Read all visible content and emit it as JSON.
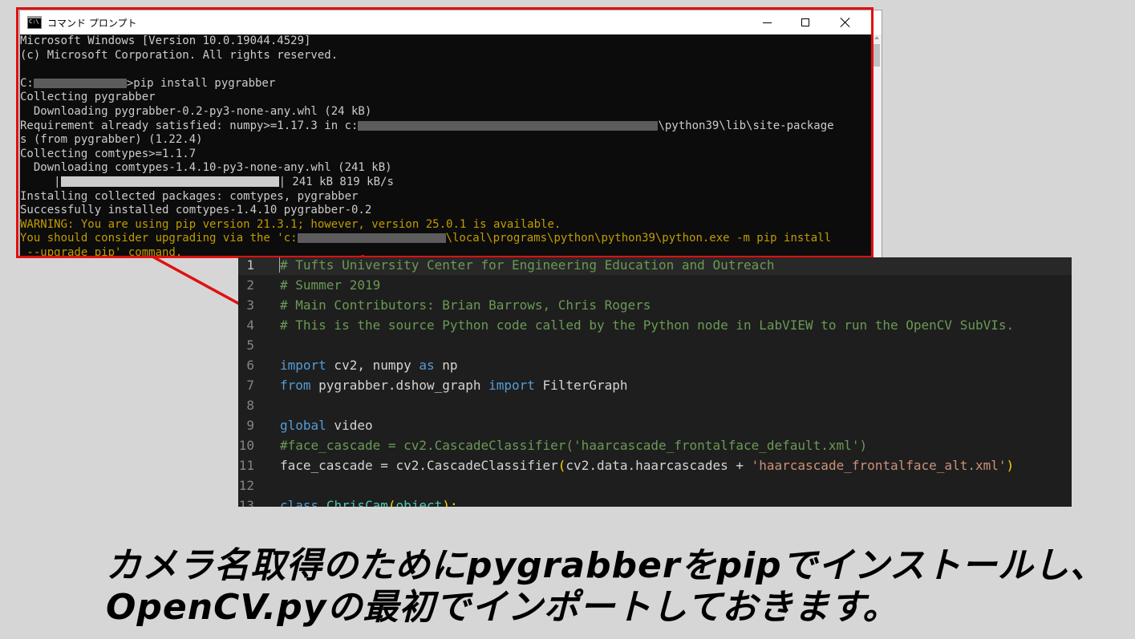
{
  "cmd_window": {
    "icon_label": "C:\\",
    "title": "コマンド プロンプト",
    "lines": [
      {
        "type": "text",
        "text": "Microsoft Windows [Version 10.0.19044.4529]"
      },
      {
        "type": "text",
        "text": "(c) Microsoft Corporation. All rights reserved."
      },
      {
        "type": "text",
        "text": ""
      },
      {
        "type": "prompt",
        "before": "C:",
        "after": ">pip install pygrabber"
      },
      {
        "type": "text",
        "text": "Collecting pygrabber"
      },
      {
        "type": "text",
        "text": "  Downloading pygrabber-0.2-py3-none-any.whl (24 kB)"
      },
      {
        "type": "path",
        "before": "Requirement already satisfied: numpy>=1.17.3 in c:",
        "after": "\\python39\\lib\\site-package"
      },
      {
        "type": "text",
        "text": "s (from pygrabber) (1.22.4)"
      },
      {
        "type": "text",
        "text": "Collecting comtypes>=1.1.7"
      },
      {
        "type": "text",
        "text": "  Downloading comtypes-1.4.10-py3-none-any.whl (241 kB)"
      },
      {
        "type": "progress",
        "before": "     |",
        "after": "| 241 kB 819 kB/s"
      },
      {
        "type": "text",
        "text": "Installing collected packages: comtypes, pygrabber"
      },
      {
        "type": "text",
        "text": "Successfully installed comtypes-1.4.10 pygrabber-0.2"
      },
      {
        "type": "warn",
        "text": "WARNING: You are using pip version 21.3.1; however, version 25.0.1 is available."
      },
      {
        "type": "warnpath",
        "before": "You should consider upgrading via the 'c:",
        "after": "\\local\\programs\\python\\python39\\python.exe -m pip install"
      },
      {
        "type": "warn",
        "text": " --upgrade pip' command."
      }
    ]
  },
  "editor": {
    "current_line": 1,
    "lines": [
      {
        "n": "1",
        "tokens": [
          {
            "t": "# Tufts University Center for Engineering Education and Outreach",
            "c": "comment"
          }
        ]
      },
      {
        "n": "2",
        "tokens": [
          {
            "t": "# Summer 2019",
            "c": "comment"
          }
        ]
      },
      {
        "n": "3",
        "tokens": [
          {
            "t": "# Main Contributors: Brian Barrows, Chris Rogers",
            "c": "comment"
          }
        ]
      },
      {
        "n": "4",
        "tokens": [
          {
            "t": "# This is the source Python code called by the Python node in LabVIEW to run the OpenCV SubVIs.",
            "c": "comment"
          }
        ]
      },
      {
        "n": "5",
        "tokens": []
      },
      {
        "n": "6",
        "tokens": [
          {
            "t": "import",
            "c": "kw"
          },
          {
            "t": " cv2, numpy ",
            "c": "text"
          },
          {
            "t": "as",
            "c": "kw"
          },
          {
            "t": " np",
            "c": "text"
          }
        ]
      },
      {
        "n": "7",
        "tokens": [
          {
            "t": "from",
            "c": "kw"
          },
          {
            "t": " pygrabber.dshow_graph ",
            "c": "text"
          },
          {
            "t": "import",
            "c": "kw"
          },
          {
            "t": " FilterGraph",
            "c": "text"
          }
        ]
      },
      {
        "n": "8",
        "tokens": []
      },
      {
        "n": "9",
        "tokens": [
          {
            "t": "global",
            "c": "kw"
          },
          {
            "t": " video",
            "c": "text"
          }
        ]
      },
      {
        "n": "10",
        "tokens": [
          {
            "t": "#face_cascade = cv2.CascadeClassifier('haarcascade_frontalface_default.xml')",
            "c": "comment"
          }
        ]
      },
      {
        "n": "11",
        "tokens": [
          {
            "t": "face_cascade = cv2.CascadeClassifier",
            "c": "text"
          },
          {
            "t": "(",
            "c": "paren"
          },
          {
            "t": "cv2.data.haarcascades + ",
            "c": "text"
          },
          {
            "t": "'haarcascade_frontalface_alt.xml'",
            "c": "str"
          },
          {
            "t": ")",
            "c": "paren"
          }
        ]
      },
      {
        "n": "12",
        "tokens": []
      },
      {
        "n": "13",
        "tokens": [
          {
            "t": "class",
            "c": "kw"
          },
          {
            "t": " ",
            "c": "text"
          },
          {
            "t": "ChrisCam",
            "c": "cls"
          },
          {
            "t": "(",
            "c": "paren"
          },
          {
            "t": "object",
            "c": "cls"
          },
          {
            "t": "):",
            "c": "paren"
          }
        ]
      }
    ]
  },
  "caption": {
    "line1": "カメラ名取得のためにpygrabberをpipでインストールし、",
    "line2": "OpenCV.pyの最初でインポートしておきます。"
  },
  "colors": {
    "frame": "#e01010",
    "console_bg": "#0c0c0c",
    "console_text": "#cccccc",
    "console_warn": "#c19c00",
    "editor_bg": "#1e1e1e",
    "comment": "#6a9955",
    "keyword": "#569cd6",
    "string": "#ce9178"
  },
  "icons": [
    "console-app-icon",
    "minimize-icon",
    "maximize-icon",
    "close-icon",
    "scroll-up-arrow-icon"
  ]
}
